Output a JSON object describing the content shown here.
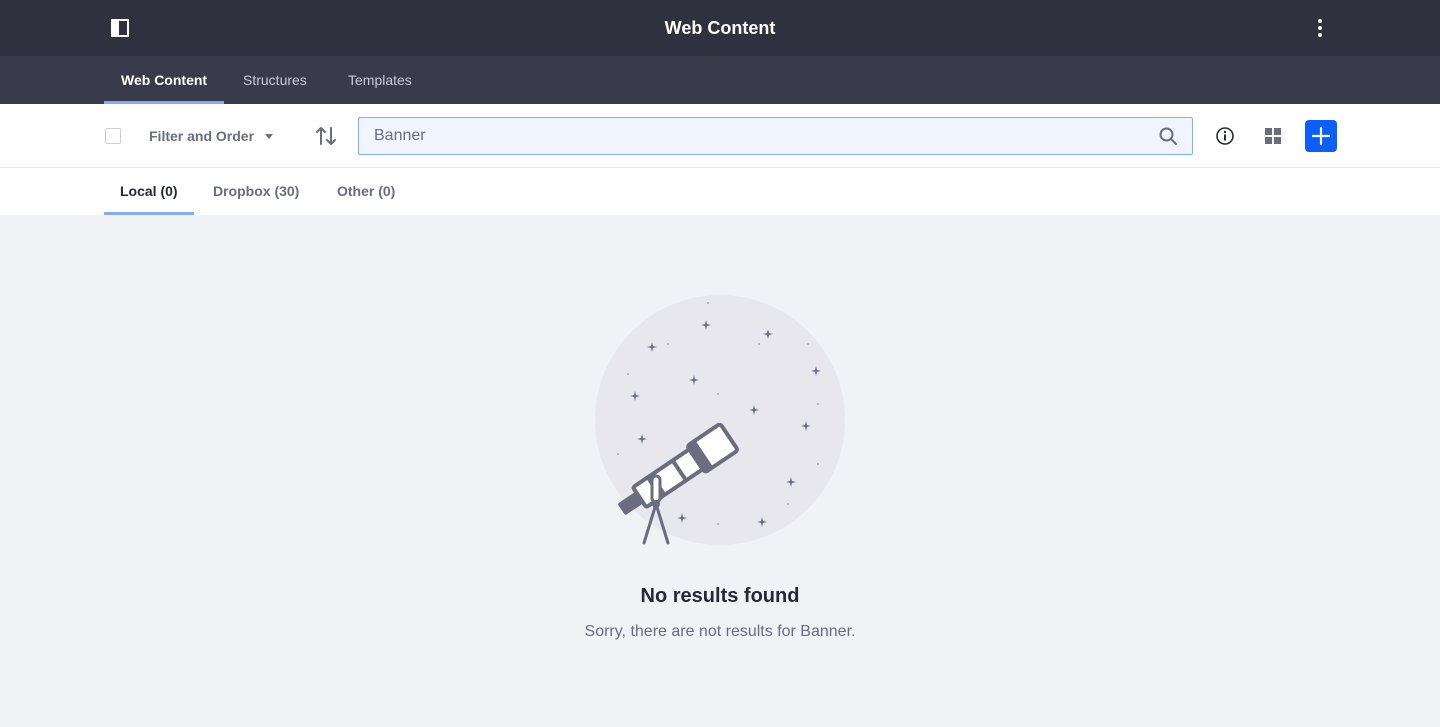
{
  "header": {
    "title": "Web Content"
  },
  "nav": {
    "tabs": [
      {
        "label": "Web Content",
        "active": true
      },
      {
        "label": "Structures",
        "active": false
      },
      {
        "label": "Templates",
        "active": false
      }
    ]
  },
  "toolbar": {
    "filter_label": "Filter and Order",
    "search_value": "Banner"
  },
  "subtabs": [
    {
      "label": "Local (0)",
      "active": true
    },
    {
      "label": "Dropbox (30)",
      "active": false
    },
    {
      "label": "Other (0)",
      "active": false
    }
  ],
  "empty_state": {
    "title": "No results found",
    "description": "Sorry, there are not results for Banner."
  },
  "colors": {
    "header_bg": "#30313f",
    "nav_bg": "#393a4a",
    "accent": "#0b5fff",
    "tab_indicator": "#80acff"
  },
  "icons": {
    "sidebar_toggle": "sidebar-toggle-icon",
    "kebab": "ellipsis-v-icon",
    "sort": "order-arrow-icon",
    "search": "search-icon",
    "info": "info-circle-icon",
    "view": "cards-grid-icon",
    "add": "plus-icon"
  }
}
